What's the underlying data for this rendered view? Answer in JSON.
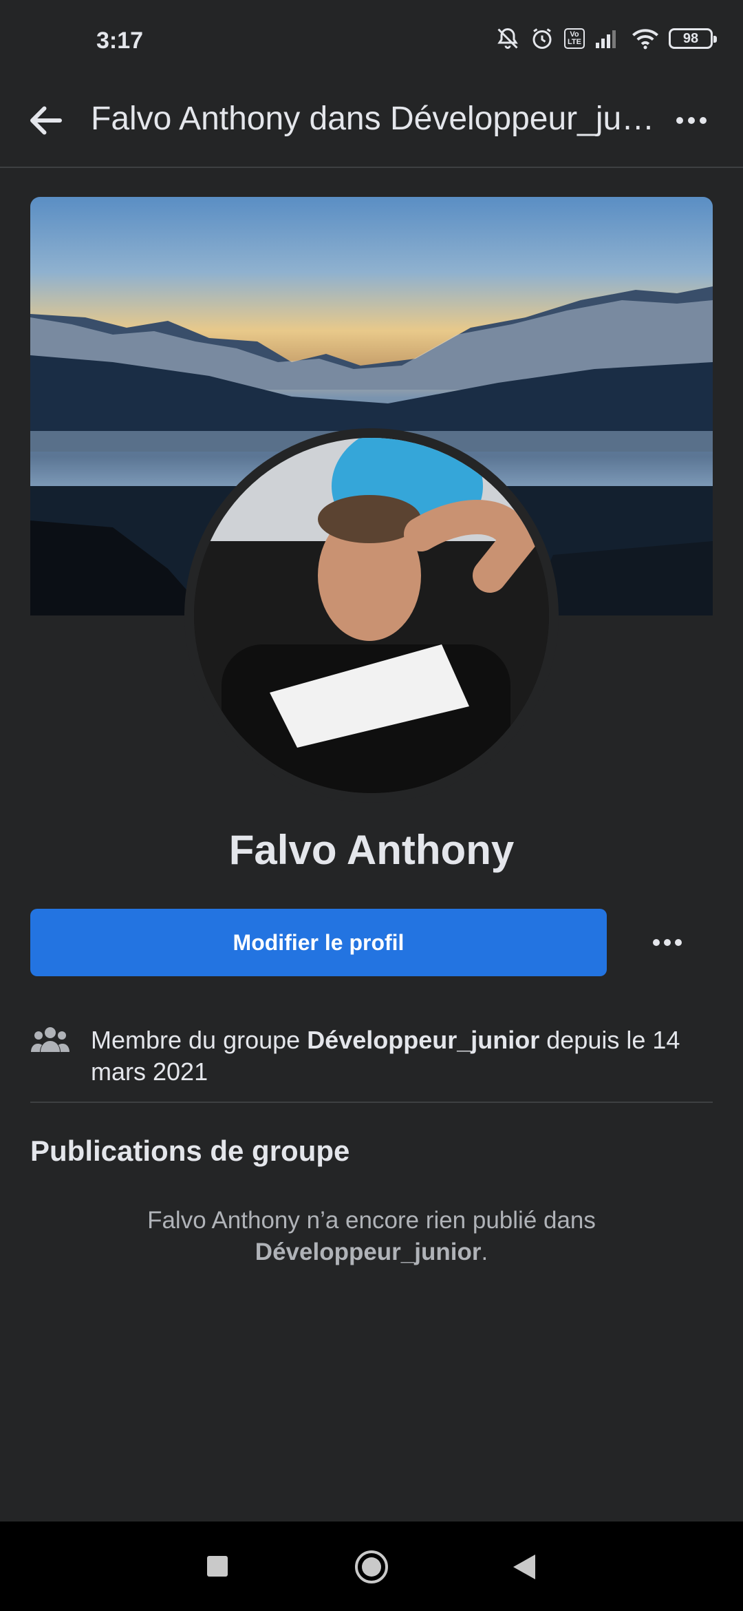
{
  "status_bar": {
    "time": "3:17",
    "volte_top": "Vo",
    "volte_bottom": "LTE",
    "battery": "98",
    "icons": [
      "notifications-off-icon",
      "alarm-icon",
      "volte-icon",
      "signal-icon",
      "wifi-icon",
      "battery-icon"
    ]
  },
  "header": {
    "title": "Falvo Anthony dans Développeur_junior",
    "back_icon": "arrow-left-icon",
    "more_icon": "more-horizontal-icon"
  },
  "profile": {
    "name": "Falvo Anthony",
    "edit_button": "Modifier le profil"
  },
  "membership": {
    "icon": "group-icon",
    "prefix": "Membre du groupe ",
    "group": "Développeur_junior",
    "suffix": " depuis le 14 mars 2021"
  },
  "posts": {
    "title": "Publications de groupe",
    "empty_prefix": "Falvo Anthony n’a encore rien publié dans ",
    "empty_group": "Développeur_junior",
    "empty_suffix": "."
  },
  "colors": {
    "background": "#242526",
    "primary": "#2374e1",
    "text": "#e4e6eb",
    "muted": "#b0b3b8"
  }
}
